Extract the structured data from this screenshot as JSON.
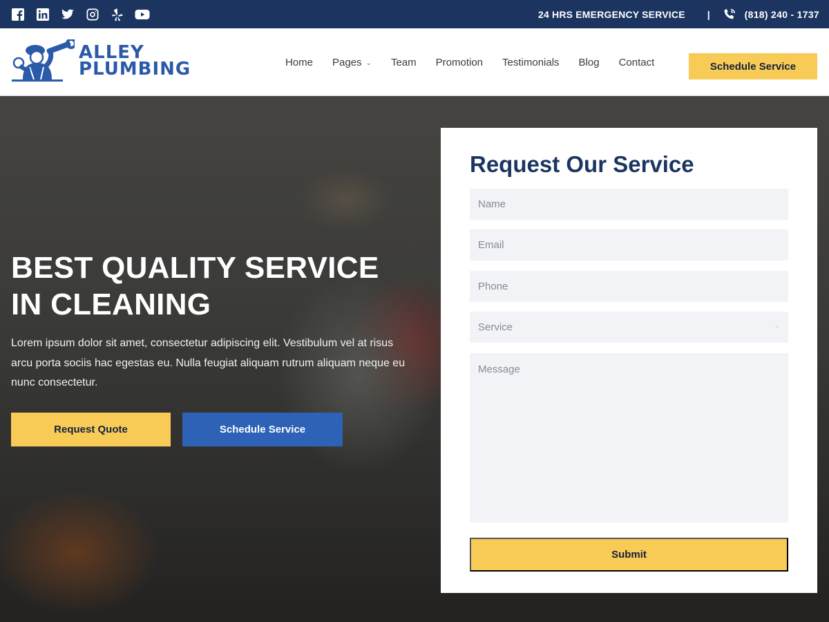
{
  "topbar": {
    "social": [
      "facebook-icon",
      "linkedin-icon",
      "twitter-icon",
      "instagram-icon",
      "yelp-icon",
      "youtube-icon"
    ],
    "emergency": "24 HRS EMERGENCY SERVICE",
    "separator": "|",
    "phone": "(818) 240 - 1737"
  },
  "header": {
    "logo_line1": "ALLEY",
    "logo_line2": "PLUMBING",
    "nav": [
      "Home",
      "Pages",
      "Team",
      "Promotion",
      "Testimonials",
      "Blog",
      "Contact"
    ],
    "cta": "Schedule Service"
  },
  "hero": {
    "title_line1": "BEST QUALITY SERVICE",
    "title_line2": "IN CLEANING",
    "text": "Lorem ipsum dolor sit amet, consectetur adipiscing elit. Vestibulum vel at risus arcu porta sociis hac egestas eu. Nulla feugiat aliquam rutrum aliquam neque eu nunc consectetur.",
    "btn_quote": "Request Quote",
    "btn_schedule": "Schedule Service"
  },
  "form": {
    "title": "Request Our Service",
    "name_placeholder": "Name",
    "email_placeholder": "Email",
    "phone_placeholder": "Phone",
    "service_placeholder": "Service",
    "message_placeholder": "Message",
    "submit": "Submit"
  },
  "colors": {
    "navy": "#1b3560",
    "brand_blue": "#2b5aa8",
    "yellow": "#f7cb55",
    "button_blue": "#2e62b7",
    "field_bg": "#f2f3f7"
  }
}
